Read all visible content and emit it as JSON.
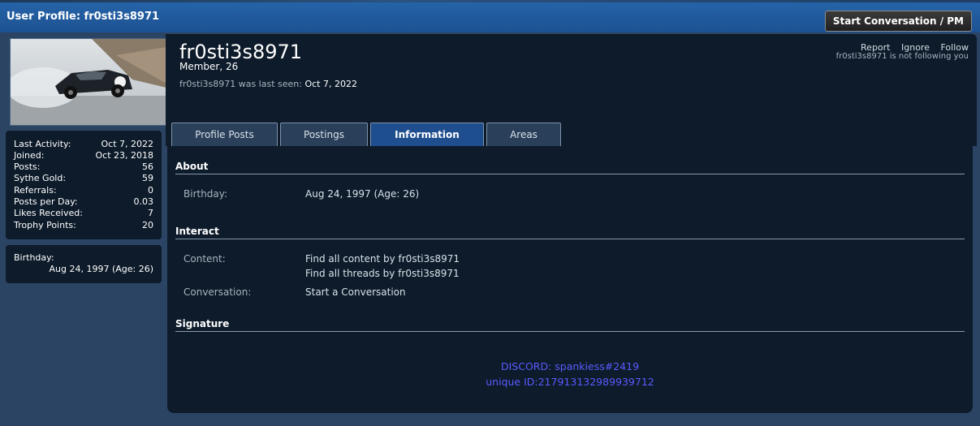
{
  "header": {
    "title": "User Profile: fr0sti3s8971",
    "pm_button": "Start Conversation / PM"
  },
  "profile": {
    "username": "fr0sti3s8971",
    "user_title": "Member, 26",
    "last_seen_prefix": "fr0sti3s8971 was last seen:",
    "last_seen_date": "Oct 7, 2022",
    "actions": [
      "Report",
      "Ignore",
      "Follow"
    ],
    "follow_note": "fr0sti3s8971 is not following you"
  },
  "tabs": [
    {
      "label": "Profile Posts"
    },
    {
      "label": "Postings"
    },
    {
      "label": "Information"
    },
    {
      "label": "Areas"
    }
  ],
  "active_tab": "Information",
  "stats": [
    {
      "label": "Last Activity:",
      "value": "Oct 7, 2022"
    },
    {
      "label": "Joined:",
      "value": "Oct 23, 2018"
    },
    {
      "label": "Posts:",
      "value": "56"
    },
    {
      "label": "Sythe Gold:",
      "value": "59"
    },
    {
      "label": "Referrals:",
      "value": "0"
    },
    {
      "label": "Posts per Day:",
      "value": "0.03"
    },
    {
      "label": "Likes Received:",
      "value": "7"
    },
    {
      "label": "Trophy Points:",
      "value": "20"
    }
  ],
  "birthday_box": {
    "label": "Birthday:",
    "value": "Aug 24, 1997 (Age: 26)"
  },
  "about": {
    "title": "About",
    "birthday_label": "Birthday:",
    "birthday_value": "Aug 24, 1997 (Age: 26)"
  },
  "interact": {
    "title": "Interact",
    "content_label": "Content:",
    "content_links": [
      "Find all content by fr0sti3s8971",
      "Find all threads by fr0sti3s8971"
    ],
    "conversation_label": "Conversation:",
    "conversation_link": "Start a Conversation"
  },
  "signature": {
    "title": "Signature",
    "line1": "DISCORD: spankiess#2419",
    "line2": "unique ID:217913132989939712",
    "color": "#5b5bff"
  },
  "colors": {
    "titlebar": "#1e5799",
    "panel": "#2b4464",
    "box": "#0d1b2a",
    "active_tab": "#1f4e8f"
  }
}
